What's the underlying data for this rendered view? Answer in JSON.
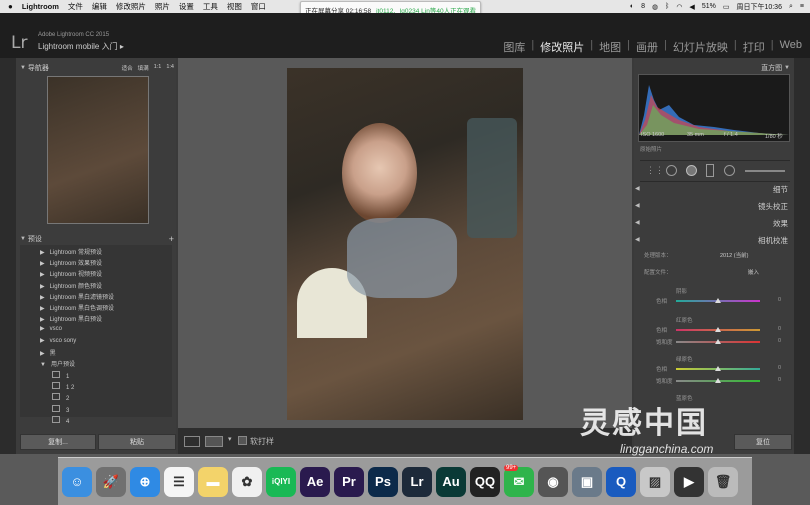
{
  "menubar": {
    "app": "Lightroom",
    "items": [
      "文件",
      "编辑",
      "修改照片",
      "照片",
      "设置",
      "工具",
      "视图",
      "窗口"
    ],
    "battery": "51%",
    "clock": "周日下午10:36",
    "num": "8"
  },
  "share": {
    "text": "正在屏幕分享 02:16:58",
    "viewers": "jt0112、lq0234 Lin等40人正在观看"
  },
  "lr": {
    "version": "Adobe Lightroom CC 2015",
    "mobile": "Lightroom mobile 入门"
  },
  "modules": [
    "图库",
    "修改照片",
    "地图",
    "画册",
    "幻灯片放映",
    "打印",
    "Web"
  ],
  "left": {
    "navigator": "导航器",
    "nav_zoom": [
      "适合",
      "填满",
      "1:1",
      "1:4"
    ],
    "presets_title": "预设",
    "presets": [
      "Lightroom 常规预设",
      "Lightroom 效果预设",
      "Lightroom 视频预设",
      "Lightroom 颜色预设",
      "Lightroom 黑白滤镜预设",
      "Lightroom 黑白色调预设",
      "Lightroom 黑白预设",
      "vsco",
      "vsco sony",
      "黑",
      "用户预设"
    ],
    "user_presets": [
      "1",
      "1 2",
      "2",
      "3",
      "4"
    ],
    "copy_btn": "复制...",
    "paste_btn": "粘贴"
  },
  "toolbar": {
    "softproof": "软打样"
  },
  "right": {
    "histogram": "直方图",
    "iso": "ISO 1600",
    "focal": "35 mm",
    "aperture": "f / 1.4",
    "shutter": "1/80 秒",
    "original": "原始照片",
    "sections": [
      "细节",
      "镜头校正",
      "效果",
      "相机校准"
    ],
    "process_label": "处理版本：",
    "process_value": "2012 (当前)",
    "profile_label": "配置文件：",
    "profile_value": "嵌入",
    "shadow": "阴影",
    "red": "红原色",
    "green": "绿原色",
    "blue": "蓝原色",
    "hue": "色调",
    "tint": "色相",
    "sat": "饱和度",
    "zero": "0",
    "reset_btn": "复位"
  },
  "watermark": {
    "brand": "灵感中国",
    "url": "lingganchina.com"
  },
  "dock": [
    {
      "name": "finder",
      "label": "☺",
      "color": "#3b8fe0"
    },
    {
      "name": "launchpad",
      "label": "🚀",
      "color": "#707070"
    },
    {
      "name": "safari",
      "label": "⊕",
      "color": "#2f8ae4"
    },
    {
      "name": "reminders",
      "label": "☰",
      "color": "#f5f5f5"
    },
    {
      "name": "notes",
      "label": "▬",
      "color": "#f3d36a"
    },
    {
      "name": "photos",
      "label": "✿",
      "color": "#f0f0f0"
    },
    {
      "name": "iqiyi",
      "label": "iQIYI",
      "color": "#19b955"
    },
    {
      "name": "ae",
      "label": "Ae",
      "color": "#2a1a4e"
    },
    {
      "name": "pr",
      "label": "Pr",
      "color": "#2a1a4e"
    },
    {
      "name": "ps",
      "label": "Ps",
      "color": "#0c2a4a"
    },
    {
      "name": "lr",
      "label": "Lr",
      "color": "#1d2a3a"
    },
    {
      "name": "au",
      "label": "Au",
      "color": "#0a3a36"
    },
    {
      "name": "qq",
      "label": "QQ",
      "color": "#222"
    },
    {
      "name": "wechat",
      "label": "✉",
      "color": "#2fb44b"
    },
    {
      "name": "camera",
      "label": "◉",
      "color": "#555"
    },
    {
      "name": "preview",
      "label": "▣",
      "color": "#6a7a8a"
    },
    {
      "name": "quicktime",
      "label": "Q",
      "color": "#1a5bbf"
    },
    {
      "name": "photo2",
      "label": "▨",
      "color": "#c8c8c8"
    },
    {
      "name": "screencast",
      "label": "▶",
      "color": "#333"
    },
    {
      "name": "trash",
      "label": "🗑",
      "color": "#bbb"
    }
  ],
  "dock_badge": "99+"
}
